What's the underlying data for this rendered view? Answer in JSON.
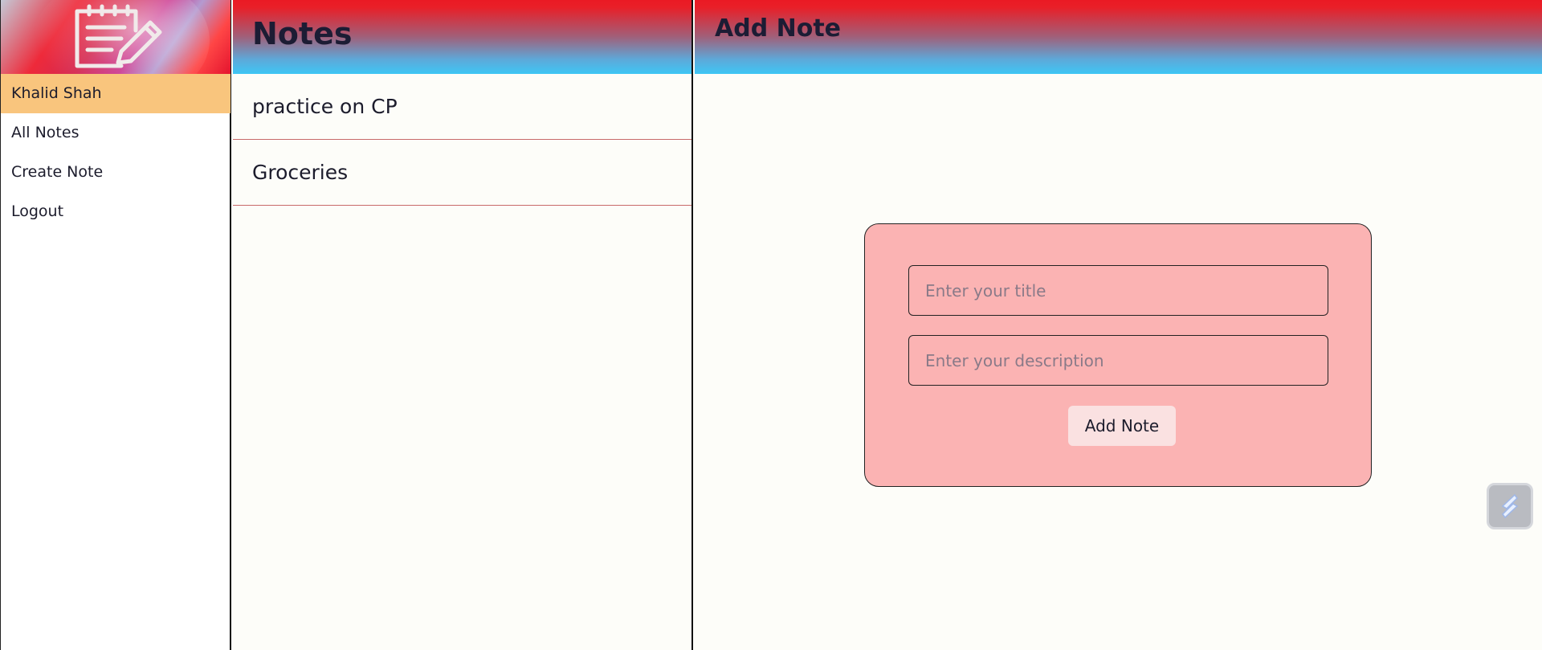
{
  "sidebar": {
    "logo_icon": "notepad-pencil-icon",
    "user_name": "Khalid Shah",
    "items": [
      {
        "label": "All Notes"
      },
      {
        "label": "Create Note"
      },
      {
        "label": "Logout"
      }
    ]
  },
  "notes_panel": {
    "title": "Notes",
    "notes": [
      {
        "title": "practice on CP"
      },
      {
        "title": "Groceries"
      }
    ]
  },
  "main_panel": {
    "title": "Add Note",
    "form": {
      "title_placeholder": "Enter your title",
      "title_value": "",
      "description_placeholder": "Enter your description",
      "description_value": "",
      "submit_label": "Add Note"
    }
  },
  "floating_button": {
    "icon": "lightning-icon"
  },
  "colors": {
    "user_highlight": "#f9c57d",
    "header_top": "#ea1a24",
    "header_bottom": "#3ec6f5",
    "form_background": "#fbb3b3",
    "submit_background": "#fae1e1",
    "note_divider": "#c86a6a"
  }
}
